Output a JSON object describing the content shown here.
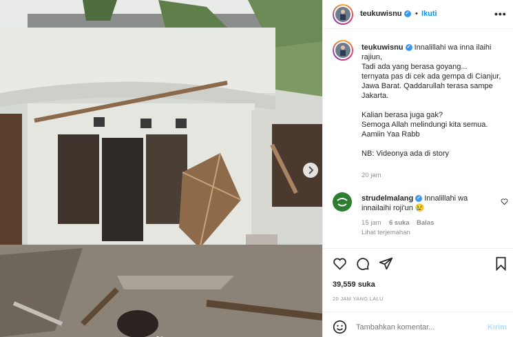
{
  "post": {
    "username": "teukuwisnu",
    "follow_label": "Ikuti",
    "separator": "•",
    "more_label": "•••",
    "caption_lines": [
      "Innalillahi wa inna ilaihi rajiun,",
      "Tadi ada yang berasa goyang...",
      "ternyata pas di cek ada gempa di Cianjur, Jawa Barat. Qaddarullah terasa sampe Jakarta.",
      "",
      "Kalian berasa juga gak?",
      "Semoga Allah melindungi kita semua.",
      "Aamiin Yaa Rabb",
      "",
      "NB: Videonya ada di story"
    ],
    "caption_time": "20 jam",
    "likes": "39,559 suka",
    "date": "20 JAM YANG LALU",
    "comment_placeholder": "Tambahkan komentar...",
    "send_label": "Kirim",
    "carousel": {
      "current": 1,
      "total": 2
    }
  },
  "comment": {
    "username": "strudelmalang",
    "text": "Innalillahi wa innailaihi roji'un 😢",
    "time": "15 jam",
    "likes": "6 suka",
    "reply_label": "Balas",
    "translate_label": "Lihat terjemahan"
  },
  "icons": [
    "heart-icon",
    "comment-icon",
    "share-icon",
    "bookmark-icon",
    "emoji-icon",
    "more-icon",
    "verified-icon",
    "next-arrow-icon"
  ],
  "colors": {
    "link": "#0095f6",
    "verified": "#3897f0",
    "muted": "#8e8e8e",
    "text": "#262626"
  }
}
